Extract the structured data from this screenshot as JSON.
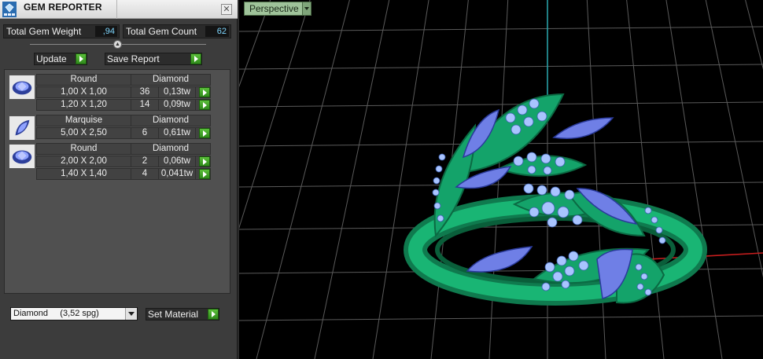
{
  "panel": {
    "title": "GEM REPORTER",
    "close_glyph": "✕",
    "stats": {
      "total_weight_label": "Total Gem Weight",
      "total_weight_value": ",94",
      "total_count_label": "Total Gem Count",
      "total_count_value": "62"
    },
    "buttons": {
      "update": "Update",
      "save_report": "Save Report",
      "set_material": "Set Material"
    },
    "material_select": {
      "value": "Diamond     (3,52 spg)"
    }
  },
  "gem_groups": [
    {
      "shape": "Round",
      "material": "Diamond",
      "rows": [
        {
          "size": "1,00 X 1,00",
          "count": "36",
          "weight": "0,13tw"
        },
        {
          "size": "1,20 X 1,20",
          "count": "14",
          "weight": "0,09tw"
        }
      ]
    },
    {
      "shape": "Marquise",
      "material": "Diamond",
      "rows": [
        {
          "size": "5,00 X 2,50",
          "count": "6",
          "weight": "0,61tw"
        }
      ]
    },
    {
      "shape": "Round",
      "material": "Diamond",
      "rows": [
        {
          "size": "2,00 X 2,00",
          "count": "2",
          "weight": "0,06tw"
        },
        {
          "size": "1,40 X 1,40",
          "count": "4",
          "weight": "0,041tw"
        }
      ]
    }
  ],
  "viewport": {
    "view_label": "Perspective",
    "colors": {
      "background": "#000000",
      "grid": "#5a5a5a",
      "axis_y": "#2aa9b0",
      "axis_x": "#c81e1e",
      "metal": "#15a36a",
      "gem": "#6f7fe6"
    }
  }
}
